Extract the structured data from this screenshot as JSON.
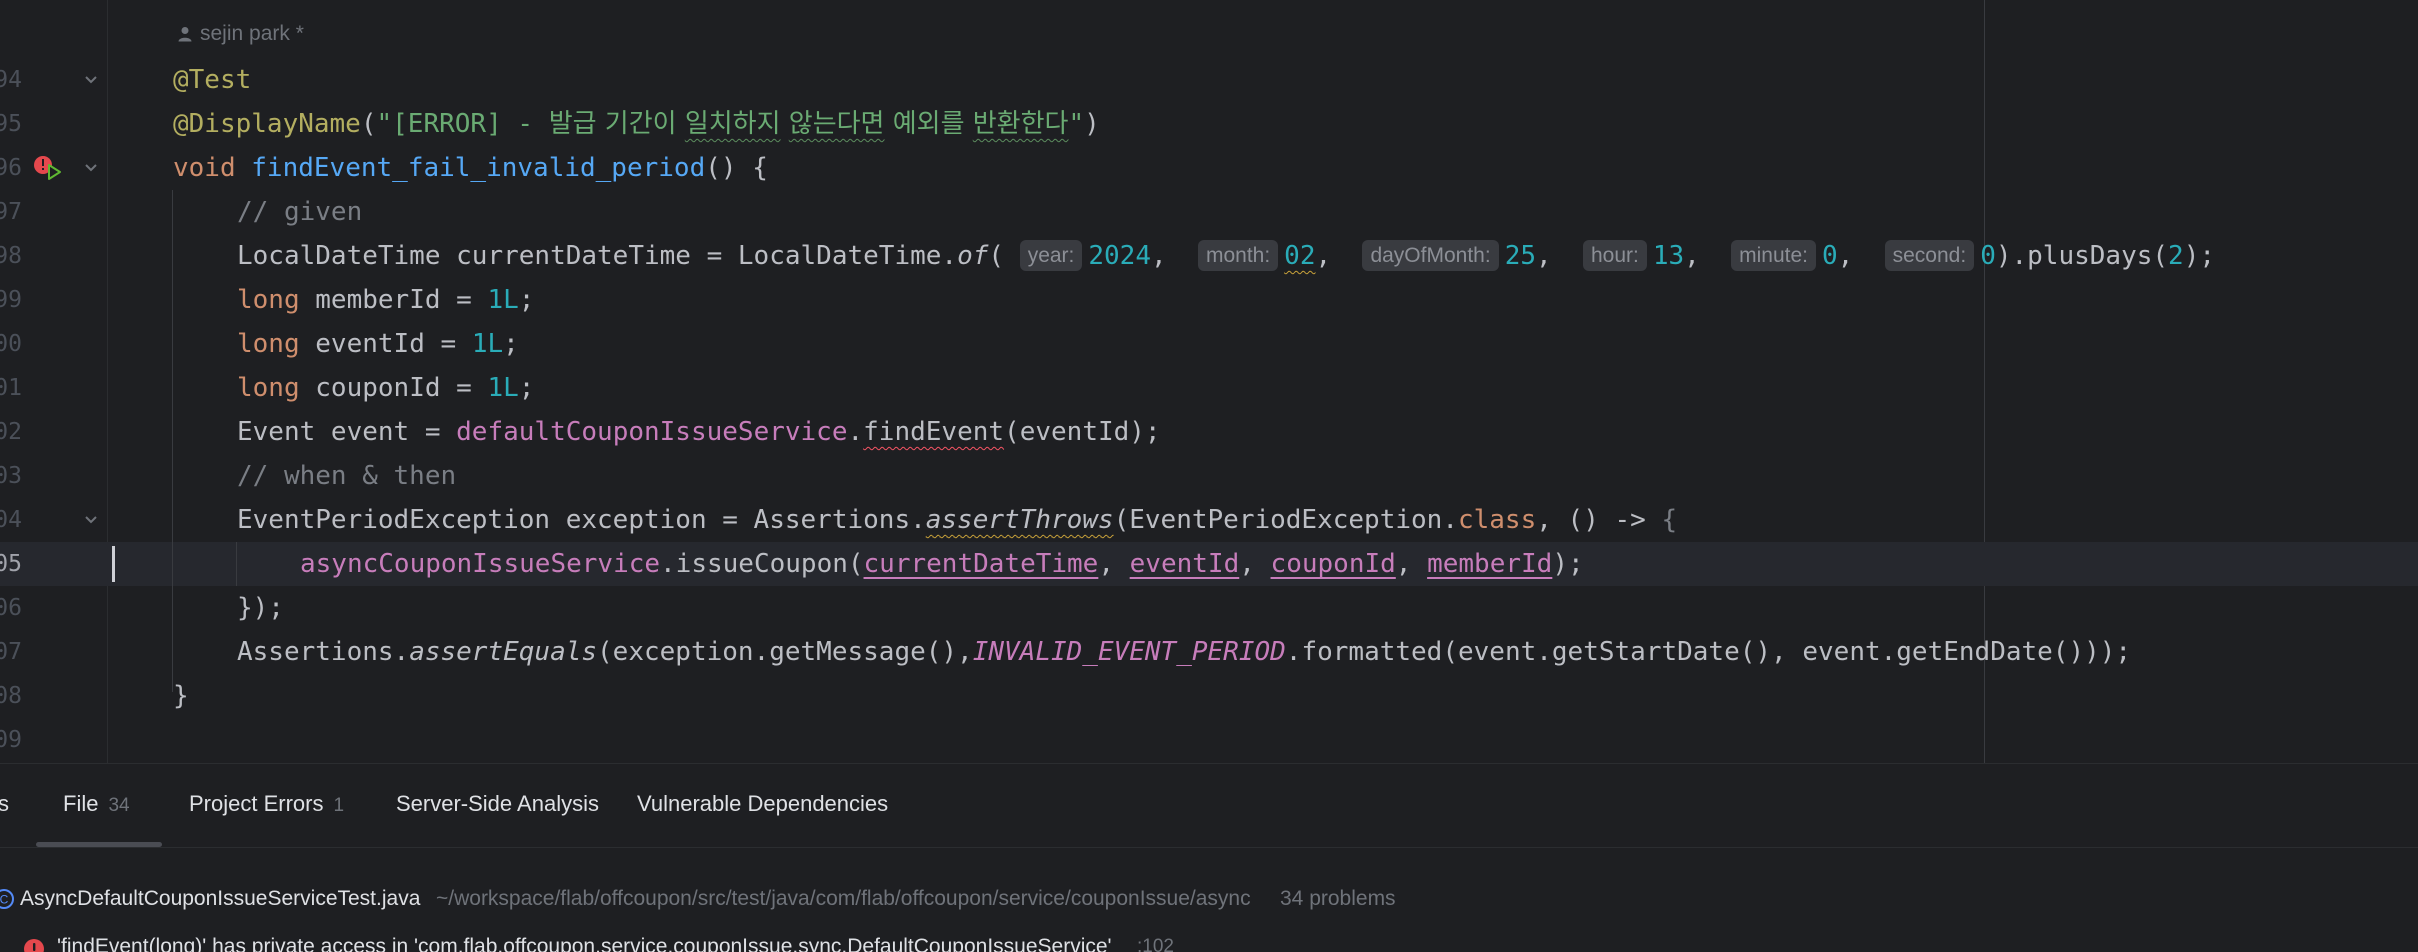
{
  "editor": {
    "author": "sejin park *",
    "lines": [
      {
        "num": "94",
        "code": "@Test"
      },
      {
        "num": "95",
        "code": "@DisplayName(\"[ERROR] - 발급 기간이 일치하지 않는다면 예외를 반환한다\")"
      },
      {
        "num": "96",
        "code": "void findEvent_fail_invalid_period() {"
      },
      {
        "num": "97",
        "code": "// given"
      },
      {
        "num": "98",
        "code": "LocalDateTime currentDateTime = LocalDateTime.of(2024, 02, 25, 13, 0, 0).plusDays(2);"
      },
      {
        "num": "99",
        "code": "long memberId = 1L;"
      },
      {
        "num": "00",
        "code": "long eventId = 1L;"
      },
      {
        "num": "01",
        "code": "long couponId = 1L;"
      },
      {
        "num": "02",
        "code": "Event event = defaultCouponIssueService.findEvent(eventId);"
      },
      {
        "num": "03",
        "code": "// when & then"
      },
      {
        "num": "04",
        "code": "EventPeriodException exception = Assertions.assertThrows(EventPeriodException.class, () -> {"
      },
      {
        "num": "05",
        "code": "asyncCouponIssueService.issueCoupon(currentDateTime, eventId, couponId, memberId);"
      },
      {
        "num": "06",
        "code": "});"
      },
      {
        "num": "07",
        "code": "Assertions.assertEquals(exception.getMessage(),INVALID_EVENT_PERIOD.formatted(event.getStartDate(), event.getEndDate()));"
      },
      {
        "num": "08",
        "code": "}"
      },
      {
        "num": "09",
        "code": ""
      }
    ],
    "hints": {
      "year": "year:",
      "month": "month:",
      "dayOfMonth": "dayOfMonth:",
      "hour": "hour:",
      "minute": "minute:",
      "second": "second:"
    }
  },
  "panel": {
    "tabs": [
      {
        "label": "s",
        "count": ""
      },
      {
        "label": "File",
        "count": "34"
      },
      {
        "label": "Project Errors",
        "count": "1"
      },
      {
        "label": "Server-Side Analysis",
        "count": ""
      },
      {
        "label": "Vulnerable Dependencies",
        "count": ""
      }
    ],
    "file": {
      "name": "AsyncDefaultCouponIssueServiceTest.java",
      "path": "~/workspace/flab/offcoupon/src/test/java/com/flab/offcoupon/service/couponIssue/async",
      "problems": "34 problems"
    },
    "problem": {
      "message": "'findEvent(long)' has private access in 'com.flab.offcoupon.service.couponIssue.sync.DefaultCouponIssueService'",
      "line": ":102"
    }
  },
  "colors": {
    "background": "#1e1f22",
    "keyword": "#cf8e6d",
    "annotation": "#b3ae60",
    "string": "#6aab73",
    "comment": "#7a7e85",
    "number": "#2aacb8",
    "method": "#56a8f5",
    "field": "#c77dbb",
    "error": "#e5484d"
  }
}
